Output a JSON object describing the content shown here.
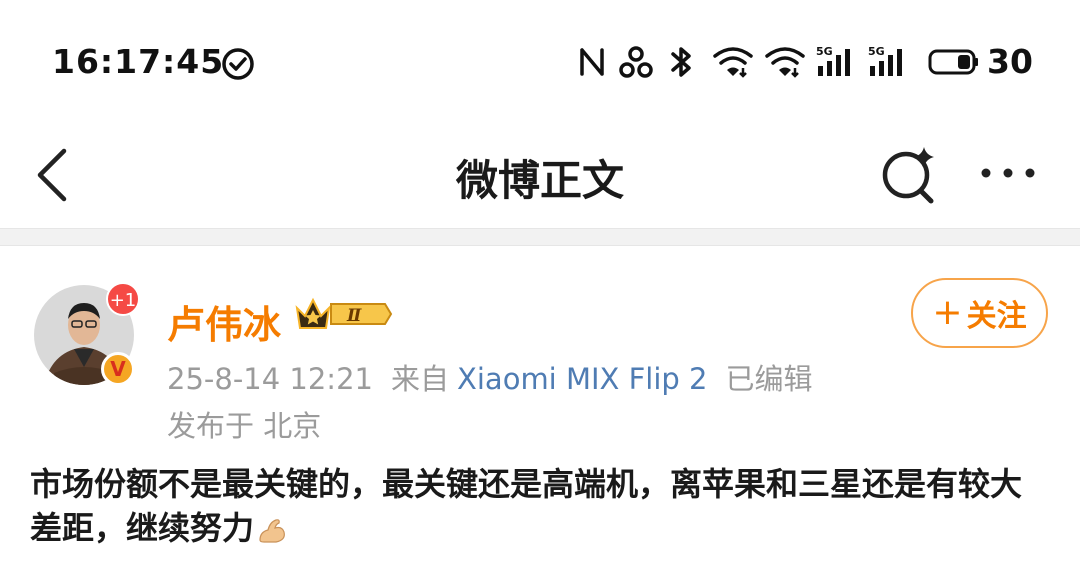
{
  "status_bar": {
    "time": "16:17:45",
    "battery_level": "30",
    "icons": [
      "check-circle-icon",
      "nfc-icon",
      "hotspot-link-icon",
      "bluetooth-icon",
      "wifi-icon",
      "wifi-icon",
      "signal-5g-icon",
      "signal-5g-icon",
      "battery-icon"
    ]
  },
  "nav": {
    "title": "微博正文",
    "back_icon": "chevron-left-icon",
    "search_icon": "ai-search-icon",
    "more_icon": "more-horizontal-icon"
  },
  "post": {
    "author": {
      "name": "卢伟冰",
      "badge_count": "+1",
      "verified_mark": "V",
      "level_badge": "Ⅱ"
    },
    "follow_label": "关注",
    "time": "25-8-14 12:21",
    "source_prefix": "来自",
    "source": "Xiaomi MIX Flip 2",
    "edited": "已编辑",
    "location": "发布于 北京",
    "text": "市场份额不是最关键的，最关键还是高端机，离苹果和三星还是有较大差距，继续努力"
  },
  "colors": {
    "accent": "#f57c00",
    "link": "#4f7cb3",
    "meta": "#9b9b9b",
    "badge_red": "#f54a45"
  }
}
